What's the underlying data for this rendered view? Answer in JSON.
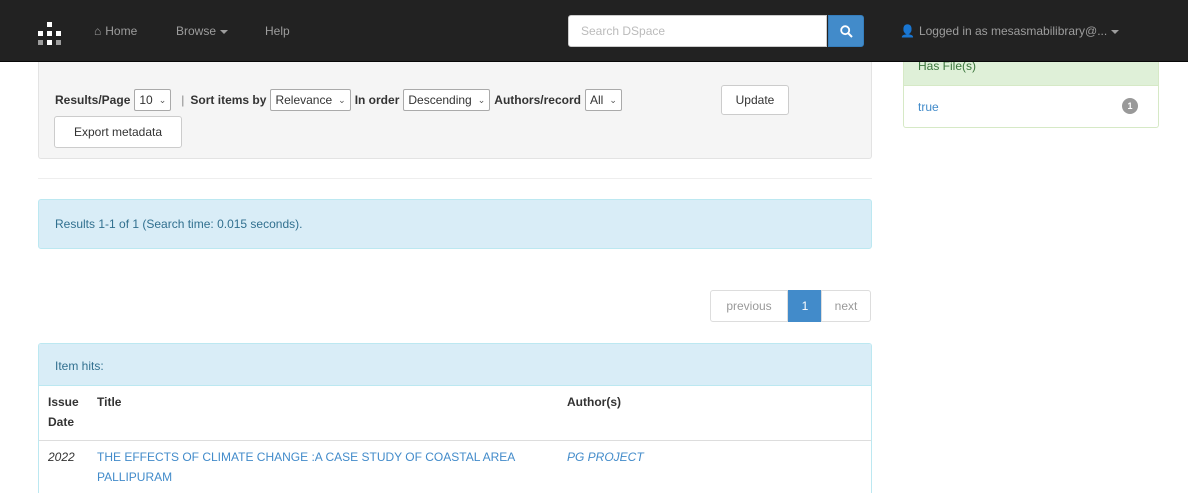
{
  "navbar": {
    "home_label": "Home",
    "browse_label": "Browse",
    "help_label": "Help",
    "search_placeholder": "Search DSpace",
    "user_label": "Logged in as mesasmabilibrary@..."
  },
  "controls": {
    "results_per_page_label": "Results/Page",
    "results_per_page_value": "10",
    "separator": "|",
    "sort_by_label": "Sort items by",
    "sort_by_value": "Relevance",
    "order_label": "In order",
    "order_value": "Descending",
    "authors_label": "Authors/record",
    "authors_value": "All",
    "update_label": "Update",
    "export_label": "Export metadata"
  },
  "results_info": "Results 1-1 of 1 (Search time: 0.015 seconds).",
  "pagination": {
    "previous_label": "previous",
    "current_page": "1",
    "next_label": "next"
  },
  "item_hits": {
    "heading": "Item hits:",
    "columns": [
      "Issue Date",
      "Title",
      "Author(s)"
    ],
    "rows": [
      {
        "date": "2022",
        "title": "THE EFFECTS OF CLIMATE CHANGE :A CASE STUDY OF COASTAL AREA PALLIPURAM",
        "author": "PG PROJECT"
      }
    ]
  },
  "facet": {
    "heading": "Has File(s)",
    "items": [
      {
        "label": "true",
        "count": "1"
      }
    ]
  },
  "colors": {
    "navbar_bg": "#222222",
    "primary": "#428bca",
    "info_bg": "#d9edf7",
    "success_bg": "#dff0d8"
  }
}
